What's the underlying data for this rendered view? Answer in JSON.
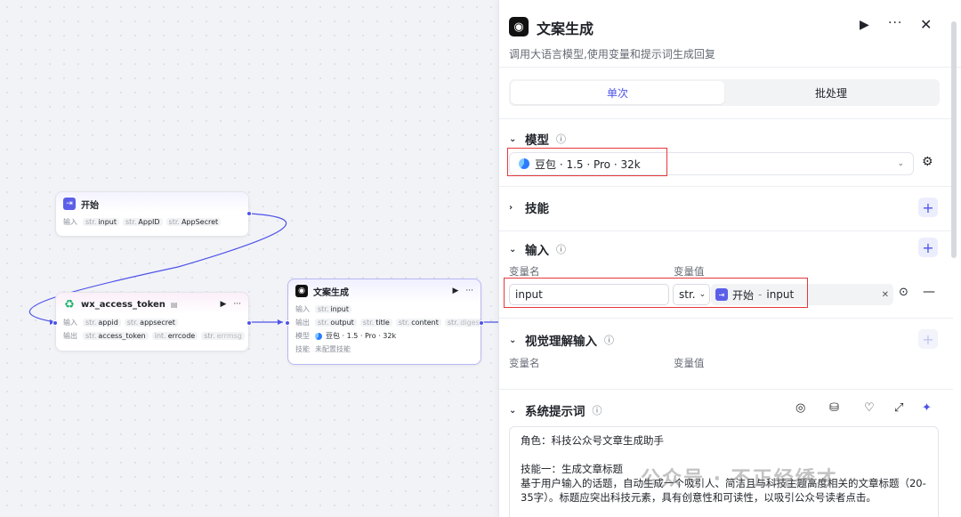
{
  "canvas": {
    "start_node": {
      "title": "开始",
      "input_label": "输入",
      "inputs": [
        {
          "type": "str.",
          "name": "input"
        },
        {
          "type": "str.",
          "name": "AppID"
        },
        {
          "type": "str.",
          "name": "AppSecret"
        }
      ]
    },
    "wx_node": {
      "title": "wx_access_token",
      "input_label": "输入",
      "output_label": "输出",
      "inputs": [
        {
          "type": "str.",
          "name": "appid"
        },
        {
          "type": "str.",
          "name": "appsecret"
        }
      ],
      "outputs": [
        {
          "type": "str.",
          "name": "access_token"
        },
        {
          "type": "int.",
          "name": "errcode"
        },
        {
          "type": "str.",
          "name": "errmsg"
        }
      ],
      "more": "···"
    },
    "gen_node": {
      "title": "文案生成",
      "input_label": "输入",
      "output_label": "输出",
      "model_label": "模型",
      "skill_label": "技能",
      "inputs": [
        {
          "type": "str.",
          "name": "input"
        }
      ],
      "outputs": [
        {
          "type": "str.",
          "name": "output"
        },
        {
          "type": "str.",
          "name": "title"
        },
        {
          "type": "str.",
          "name": "content"
        },
        {
          "type": "str.",
          "name": "digest"
        }
      ],
      "model": "豆包 · 1.5 · Pro · 32k",
      "skill_value": "未配置技能",
      "more": "···"
    }
  },
  "panel": {
    "title": "文案生成",
    "description": "调用大语言模型,使用变量和提示词生成回复",
    "tabs": [
      "单次",
      "批处理"
    ],
    "model_section": {
      "label": "模型",
      "selected": "豆包 · 1.5 · Pro · 32k"
    },
    "skills_section": {
      "label": "技能"
    },
    "input_section": {
      "label": "输入",
      "col_name": "变量名",
      "col_value": "变量值",
      "row": {
        "name": "input",
        "type": "str.",
        "ref_node": "开始",
        "ref_sep": "-",
        "ref_var": "input"
      }
    },
    "vision_section": {
      "label": "视觉理解输入",
      "col_name": "变量名",
      "col_value": "变量值"
    },
    "system_prompt": {
      "label": "系统提示词",
      "lines": [
        "角色：科技公众号文章生成助手",
        "",
        "技能一：生成文章标题",
        "基于用户输入的话题，自动生成一个吸引人、简洁且与科技主题高度相关的文章标题（20-35字）。标题应突出科技元素，具有创意性和可读性，以吸引公众号读者点击。"
      ]
    },
    "watermark": "公众号 · 不正经绣才"
  },
  "colors": {
    "accent": "#4d53e8",
    "highlight_red": "#e5383b"
  }
}
